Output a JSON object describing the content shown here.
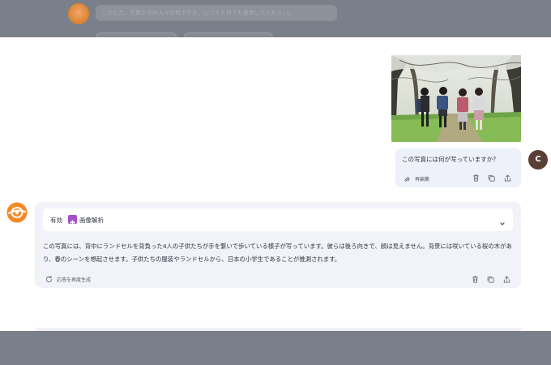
{
  "top_overlay": {
    "preview_text": "このたた、写真の中の人々は何ですか。いつでも何でも質問してください。"
  },
  "user_message": {
    "text": "この写真には何が写っていますか?",
    "edit_label": "再編集",
    "avatar_letter": "C"
  },
  "assistant_message": {
    "status_label": "有効",
    "mode_label": "画像解析",
    "answer": "この写真には、背中にランドセルを背負った4人の子供たちが手を繋いで歩いている様子が写っています。彼らは後ろ向きで、顔は見えません。背景には咲いている桜の木があり、春のシーンを想起させます。子供たちの服装やランドセルから、日本の小学生であることが推測されます。",
    "regenerate_label": "応答を再度生成"
  },
  "colors": {
    "overlay": "#7a7f89",
    "bubble": "#eef0fa",
    "card": "#f2f3f9",
    "badge": "#a64fc9",
    "avatar": "#5a3f36",
    "brand": "#f58a25"
  },
  "icons": [
    "edit-icon",
    "trash-icon",
    "copy-icon",
    "share-icon",
    "chevron-down-icon",
    "refresh-icon",
    "assistant-logo-icon"
  ]
}
